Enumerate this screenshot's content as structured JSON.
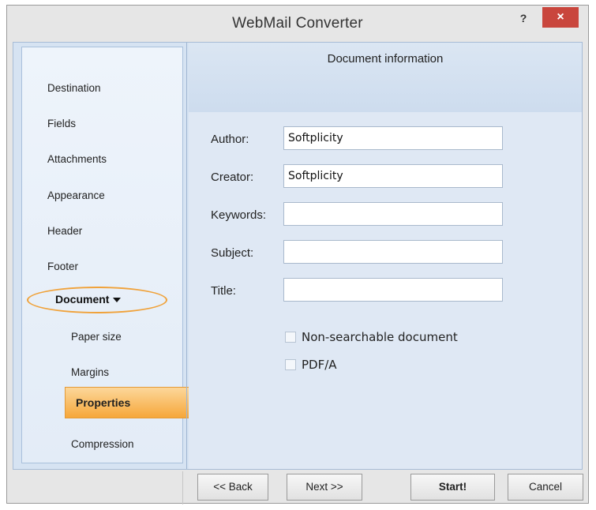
{
  "window": {
    "title": "WebMail Converter",
    "help_label": "?",
    "close_label": "×"
  },
  "nav": {
    "items": [
      {
        "label": "Destination"
      },
      {
        "label": "Fields"
      },
      {
        "label": "Attachments"
      },
      {
        "label": "Appearance"
      },
      {
        "label": "Header"
      },
      {
        "label": "Footer"
      }
    ],
    "expanded_section": {
      "label": "Document",
      "expanded": true
    },
    "sub_items": [
      {
        "label": "Paper size"
      },
      {
        "label": "Margins"
      },
      {
        "label": "Properties",
        "selected": true
      },
      {
        "label": "Compression"
      }
    ]
  },
  "panel": {
    "header_title": "Document information",
    "fields": [
      {
        "label": "Author:",
        "value": "Softplicity"
      },
      {
        "label": "Creator:",
        "value": "Softplicity"
      },
      {
        "label": "Keywords:",
        "value": ""
      },
      {
        "label": "Subject:",
        "value": ""
      },
      {
        "label": "Title:",
        "value": ""
      }
    ],
    "checkboxes": [
      {
        "label": "Non-searchable document",
        "checked": false
      },
      {
        "label": "PDF/A",
        "checked": false
      }
    ]
  },
  "footer": {
    "back_label": "<< Back",
    "next_label": "Next >>",
    "start_label": "Start!",
    "cancel_label": "Cancel"
  },
  "colors": {
    "selection_orange": "#f6a73a",
    "highlight_ellipse": "#f0a23a",
    "close_red": "#c9463d",
    "panel_blue": "#dfe8f4"
  }
}
